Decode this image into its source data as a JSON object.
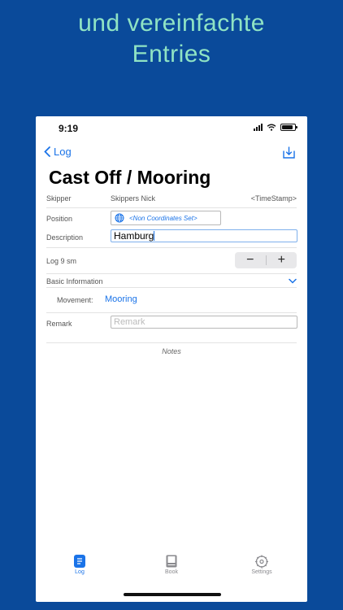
{
  "banner": {
    "line1": "und vereinfachte",
    "line2": "Entries"
  },
  "status": {
    "time": "9:19"
  },
  "nav": {
    "back_label": "Log",
    "share_icon": "share-download-icon"
  },
  "title": "Cast Off / Mooring",
  "skipper": {
    "label": "Skipper",
    "value": "Skippers Nick",
    "timestamp": "<TimeStamp>"
  },
  "position": {
    "label": "Position",
    "value": "<Non Coordinates Set>"
  },
  "description": {
    "label": "Description",
    "value": "Hamburg"
  },
  "log": {
    "label": "Log 9 sm",
    "minus": "−",
    "plus": "+"
  },
  "basic_info": {
    "label": "Basic Information"
  },
  "movement": {
    "label": "Movement:",
    "value": "Mooring"
  },
  "remark": {
    "label": "Remark",
    "placeholder": "Remark"
  },
  "notes": "Notes",
  "tabs": [
    {
      "label": "Log",
      "icon": "log-icon",
      "active": true
    },
    {
      "label": "Book",
      "icon": "book-icon",
      "active": false
    },
    {
      "label": "Settings",
      "icon": "settings-icon",
      "active": false
    }
  ],
  "colors": {
    "background": "#0a4a9a",
    "banner_text": "#8fe3c4",
    "accent": "#1a73e8"
  }
}
